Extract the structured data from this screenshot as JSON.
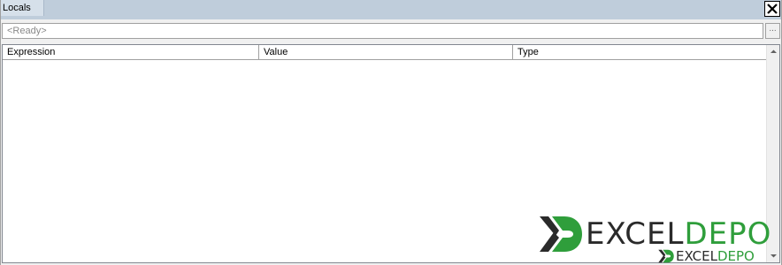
{
  "window": {
    "title": "Locals"
  },
  "context": {
    "value": "<Ready>",
    "ellipsis_label": "..."
  },
  "columns": [
    {
      "label": "Expression"
    },
    {
      "label": "Value"
    },
    {
      "label": "Type"
    }
  ],
  "rows": [],
  "watermark": {
    "part_dark": "EXCEL",
    "part_green": "DEPO"
  },
  "colors": {
    "titlebar": "#bfcddb",
    "brand_green": "#2f9e3b",
    "brand_dark": "#2a2a2a"
  },
  "icons": {
    "close": "close-icon",
    "scroll_up": "scroll-up-arrow-icon",
    "scroll_down": "scroll-down-arrow-icon",
    "logo": "excel-depo-x-logo-icon"
  }
}
